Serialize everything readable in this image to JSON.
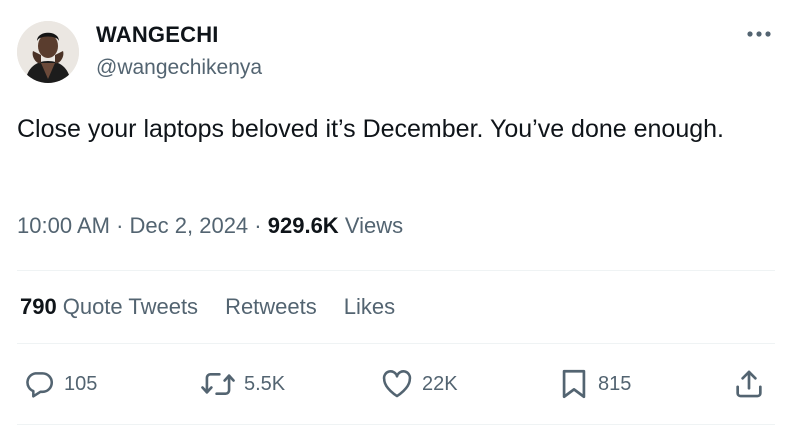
{
  "author": {
    "display_name": "WANGECHI",
    "handle": "@wangechikenya"
  },
  "tweet": {
    "text": "Close your laptops beloved it’s December. You’ve done enough."
  },
  "meta": {
    "time": "10:00 AM",
    "separator": "·",
    "date": "Dec 2, 2024",
    "views_count": "929.6K",
    "views_label": "Views"
  },
  "stats": {
    "quote_count": "790",
    "quote_label": "Quote Tweets",
    "retweets_label": "Retweets",
    "likes_label": "Likes"
  },
  "actions": {
    "replies": "105",
    "retweets": "5.5K",
    "likes": "22K",
    "bookmarks": "815"
  },
  "icons": {
    "more": "more-horizontal-icon",
    "reply": "reply-icon",
    "retweet": "retweet-icon",
    "like": "heart-icon",
    "bookmark": "bookmark-icon",
    "share": "share-icon"
  },
  "colors": {
    "text_primary": "#0f1419",
    "text_secondary": "#536471",
    "divider": "#eff3f4"
  }
}
